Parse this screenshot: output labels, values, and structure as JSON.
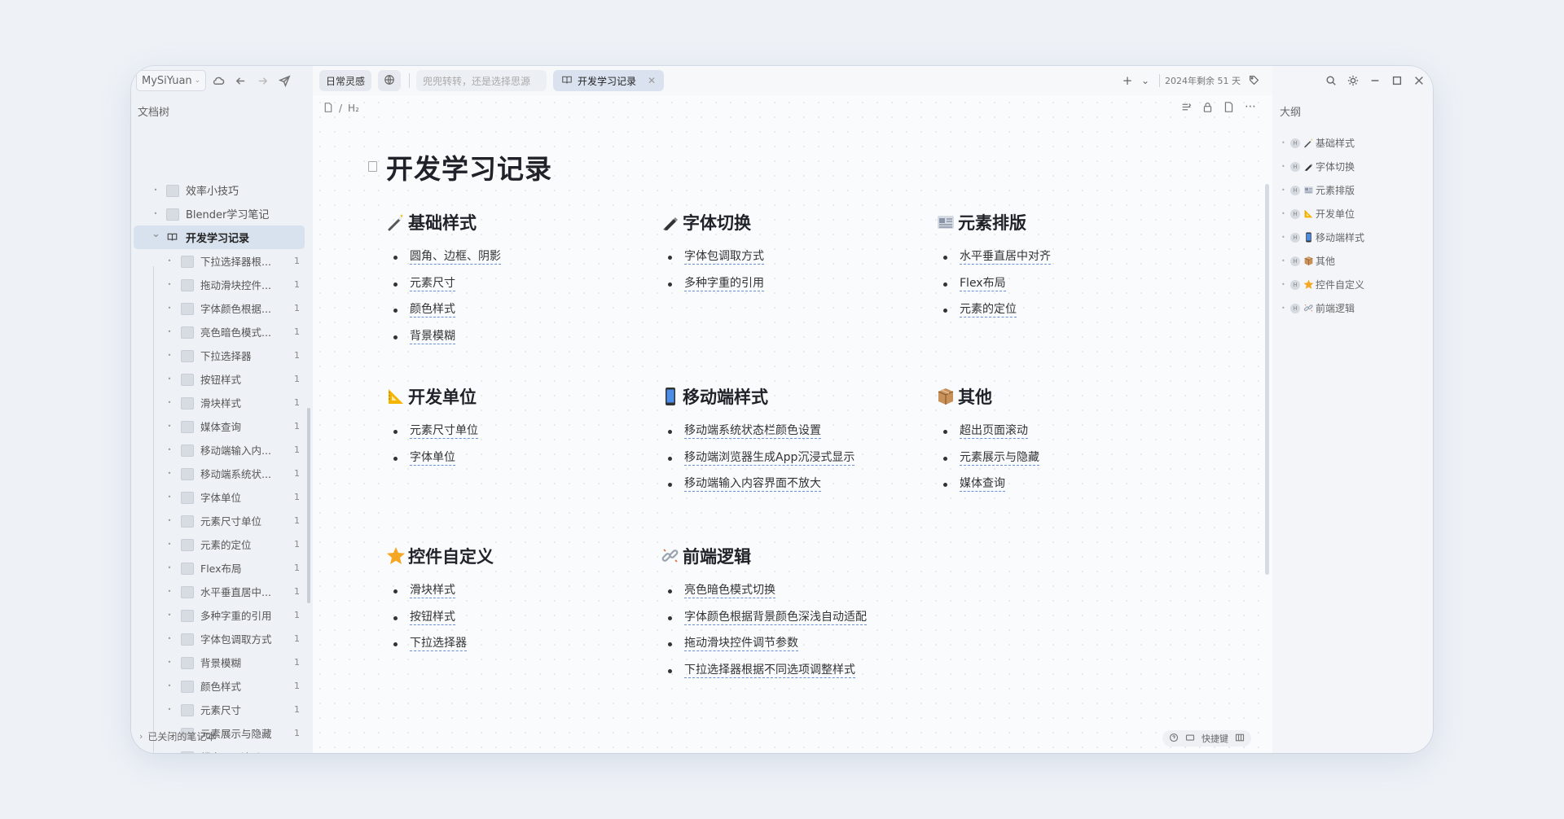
{
  "workspace": "MySiYuan",
  "left_panel": {
    "title": "文档树",
    "closed_notebooks": "已关闭的笔记本",
    "tree": [
      {
        "label": "效率小技巧",
        "count": "",
        "level": 1
      },
      {
        "label": "Blender学习笔记",
        "count": "",
        "level": 1
      },
      {
        "label": "开发学习记录",
        "count": "",
        "level": 1,
        "expanded": true,
        "active": true
      },
      {
        "label": "下拉选择器根...",
        "count": "1",
        "level": 2
      },
      {
        "label": "拖动滑块控件...",
        "count": "1",
        "level": 2
      },
      {
        "label": "字体颜色根据...",
        "count": "1",
        "level": 2
      },
      {
        "label": "亮色暗色模式...",
        "count": "1",
        "level": 2
      },
      {
        "label": "下拉选择器",
        "count": "1",
        "level": 2
      },
      {
        "label": "按钮样式",
        "count": "1",
        "level": 2
      },
      {
        "label": "滑块样式",
        "count": "1",
        "level": 2
      },
      {
        "label": "媒体查询",
        "count": "1",
        "level": 2
      },
      {
        "label": "移动端输入内...",
        "count": "1",
        "level": 2
      },
      {
        "label": "移动端系统状...",
        "count": "1",
        "level": 2
      },
      {
        "label": "字体单位",
        "count": "1",
        "level": 2
      },
      {
        "label": "元素尺寸单位",
        "count": "1",
        "level": 2
      },
      {
        "label": "元素的定位",
        "count": "1",
        "level": 2
      },
      {
        "label": "Flex布局",
        "count": "1",
        "level": 2
      },
      {
        "label": "水平垂直居中...",
        "count": "1",
        "level": 2
      },
      {
        "label": "多种字重的引用",
        "count": "1",
        "level": 2
      },
      {
        "label": "字体包调取方式",
        "count": "1",
        "level": 2
      },
      {
        "label": "背景模糊",
        "count": "1",
        "level": 2
      },
      {
        "label": "颜色样式",
        "count": "1",
        "level": 2
      },
      {
        "label": "元素尺寸",
        "count": "1",
        "level": 2
      },
      {
        "label": "元素展示与隐藏",
        "count": "1",
        "level": 2
      },
      {
        "label": "超出页面滚动",
        "count": "1",
        "level": 2
      }
    ]
  },
  "tabs": {
    "daily": "日常灵感",
    "search_placeholder": "兜兜转转，还是选择思源",
    "active_tab": "开发学习记录",
    "date_status": "2024年剩余 51 天"
  },
  "breadcrumb": {
    "heading_marker": "H₂"
  },
  "document": {
    "title": "开发学习记录",
    "sections": [
      {
        "title": "基础样式",
        "icon": "magic-wand-icon",
        "items": [
          "圆角、边框、阴影",
          "元素尺寸",
          "颜色样式",
          "背景模糊"
        ]
      },
      {
        "title": "字体切换",
        "icon": "pen-icon",
        "items": [
          "字体包调取方式",
          "多种字重的引用"
        ]
      },
      {
        "title": "元素排版",
        "icon": "newspaper-icon",
        "items": [
          "水平垂直居中对齐",
          "Flex布局",
          "元素的定位"
        ]
      },
      {
        "title": "开发单位",
        "icon": "triangle-ruler-icon",
        "items": [
          "元素尺寸单位",
          "字体单位"
        ]
      },
      {
        "title": "移动端样式",
        "icon": "mobile-phone-icon",
        "items": [
          "移动端系统状态栏颜色设置",
          "移动端浏览器生成App沉浸式显示",
          "移动端输入内容界面不放大"
        ]
      },
      {
        "title": "其他",
        "icon": "package-icon",
        "items": [
          "超出页面滚动",
          "元素展示与隐藏",
          "媒体查询"
        ]
      },
      {
        "title": "控件自定义",
        "icon": "star-icon",
        "items": [
          "滑块样式",
          "按钮样式",
          "下拉选择器"
        ]
      },
      {
        "title": "前端逻辑",
        "icon": "link-icon",
        "items": [
          "亮色暗色模式切换",
          "字体颜色根据背景颜色深浅自动适配",
          "拖动滑块控件调节参数",
          "下拉选择器根据不同选项调整样式"
        ]
      }
    ]
  },
  "status_bar": {
    "shortcut": "快捷键"
  },
  "right_panel": {
    "title": "大纲",
    "items": [
      "基础样式",
      "字体切换",
      "元素排版",
      "开发单位",
      "移动端样式",
      "其他",
      "控件自定义",
      "前端逻辑"
    ]
  },
  "colors": {
    "accent": "#6a8fd6",
    "active_row": "#d8e1ee",
    "background": "#eef2f7"
  }
}
